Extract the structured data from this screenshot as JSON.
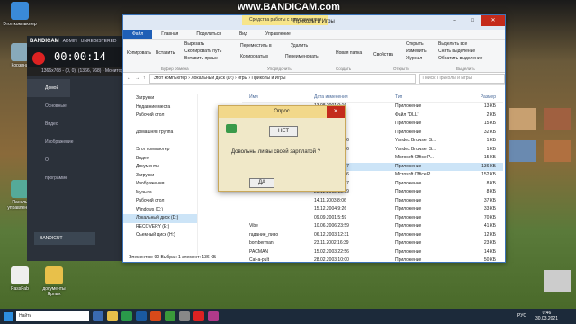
{
  "watermark": "www.BANDICAM.com",
  "desktop_icons": [
    {
      "label": "Этот компьютер"
    },
    {
      "label": "Корзина"
    },
    {
      "label": "Панель управления"
    },
    {
      "label": "PassFab"
    },
    {
      "label": "документы Ярлык"
    }
  ],
  "bandicam": {
    "logo": "BANDICAM",
    "admin": "ADMIN",
    "unregistered": "UNREGISTERED",
    "timer": "00:00:14",
    "resolution": "1366x768 - (0, 0), (1366, 768) - Монитор 1",
    "nav": [
      "Домой",
      "Основные",
      "Видео",
      "Изображение",
      "О программе"
    ],
    "bandicut": "BANDICUT"
  },
  "explorer": {
    "tools_tab": "Средства работы с приложениями",
    "title": "Приколы и Игры",
    "tabs": [
      "Файл",
      "Главная",
      "Поделиться",
      "Вид",
      "Управление"
    ],
    "ribbon": {
      "copy": "Копировать",
      "paste": "Вставить",
      "cut": "Вырезать",
      "copy_path": "Скопировать путь",
      "paste_shortcut": "Вставить ярлык",
      "clipboard_group": "Буфер обмена",
      "move_to": "Переместить в",
      "copy_to": "Копировать в",
      "delete": "Удалить",
      "rename": "Переименовать",
      "organize_group": "Упорядочить",
      "new_folder": "Новая папка",
      "create_group": "Создать",
      "properties": "Свойства",
      "open": "Открыть",
      "edit": "Изменить",
      "journal": "Журнал",
      "open_group": "Открыть",
      "select_all": "Выделить все",
      "select_none": "Снять выделение",
      "invert_selection": "Обратить выделение",
      "select_group": "Выделить"
    },
    "address": "Этот компьютер › Локальный диск (D:) › игры › Приколы и Игры",
    "search_placeholder": "Поиск: Приколы и Игры",
    "nav_items": [
      "Загрузки",
      "Недавние места",
      "Рабочий стол",
      "",
      "Домашняя группа",
      "",
      "Этот компьютер",
      "Видео",
      "Документы",
      "Загрузки",
      "Изображения",
      "Музыка",
      "Рабочий стол",
      "Windows (C:)",
      "Локальный диск (D:)",
      "RECOVERY (E:)",
      "Съемный диск (H:)"
    ],
    "columns": [
      "Имя",
      "Дата изменения",
      "Тип",
      "Размер"
    ],
    "files": [
      {
        "name": "",
        "date": "13.08.2001 0:16",
        "type": "Приложение",
        "size": "13 КБ"
      },
      {
        "name": "",
        "date": "13.08.2001 0:00",
        "type": "Файл \"DLL\"",
        "size": "2 КБ"
      },
      {
        "name": "",
        "date": "17.10.2009 8:05",
        "type": "Приложение",
        "size": "15 КБ"
      },
      {
        "name": "",
        "date": "31.01.2007 8:15",
        "type": "Приложение",
        "size": "32 КБ"
      },
      {
        "name": "",
        "date": "17.06.2006 15:26",
        "type": "Yandex Browser S...",
        "size": "1 КБ"
      },
      {
        "name": "",
        "date": "17.06.2006 15:26",
        "type": "Yandex Browser S...",
        "size": "1 КБ"
      },
      {
        "name": "",
        "date": "09.11.2000 0:00",
        "type": "Microsoft Office P...",
        "size": "15 КБ"
      },
      {
        "name": "",
        "date": "29.04.2005 20:07",
        "type": "Приложение",
        "size": "136 КБ"
      },
      {
        "name": "",
        "date": "17.06.2006 15:26",
        "type": "Microsoft Office P...",
        "size": "152 КБ"
      },
      {
        "name": "",
        "date": "03.09.2002 15:17",
        "type": "Приложение",
        "size": "8 КБ"
      },
      {
        "name": "",
        "date": "25.12.2002 13:59",
        "type": "Приложение",
        "size": "8 КБ"
      },
      {
        "name": "",
        "date": "14.11.2003 8:06",
        "type": "Приложение",
        "size": "37 КБ"
      },
      {
        "name": "",
        "date": "15.12.2004 9:26",
        "type": "Приложение",
        "size": "33 КБ"
      },
      {
        "name": "",
        "date": "09.09.2001 5:59",
        "type": "Приложение",
        "size": "70 КБ"
      },
      {
        "name": "Vibe",
        "date": "10.06.2006 23:59",
        "type": "Приложение",
        "size": "41 КБ"
      },
      {
        "name": "гадание_пиво",
        "date": "06.12.2003 12:31",
        "type": "Приложение",
        "size": "12 КБ"
      },
      {
        "name": "bomberman",
        "date": "23.11.2002 16:39",
        "type": "Приложение",
        "size": "23 КБ"
      },
      {
        "name": "PACMAN",
        "date": "15.02.2003 22:56",
        "type": "Приложение",
        "size": "14 КБ"
      },
      {
        "name": "Cat-a-pult",
        "date": "28.02.2003 10:00",
        "type": "Приложение",
        "size": "50 КБ"
      }
    ],
    "status": "Элементов: 90     Выбран 1 элемент: 136 КБ"
  },
  "dialog": {
    "title": "Опрос",
    "no": "НЕТ",
    "question": "Довольны ли вы своей зарплатой ?",
    "yes": "ДА"
  },
  "taskbar": {
    "search_placeholder": "Найти",
    "lang": "РУС",
    "time": "0:46",
    "date": "30.03.2021"
  }
}
